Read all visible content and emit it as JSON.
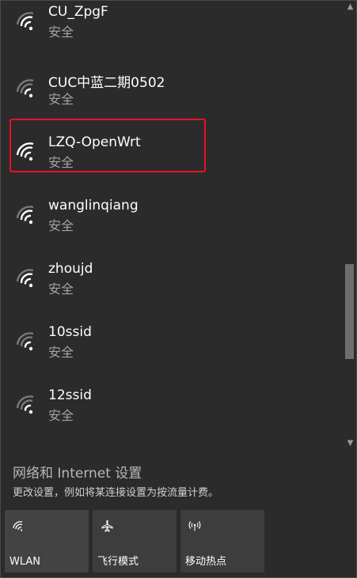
{
  "networks": [
    {
      "ssid": "CU_ZpgF",
      "status": "安全"
    },
    {
      "ssid": "CUC中蓝二期0502",
      "status": "安全"
    },
    {
      "ssid": "LZQ-OpenWrt",
      "status": "安全"
    },
    {
      "ssid": "wanglinqiang",
      "status": "安全"
    },
    {
      "ssid": "zhoujd",
      "status": "安全"
    },
    {
      "ssid": "10ssid",
      "status": "安全"
    },
    {
      "ssid": "12ssid",
      "status": "安全"
    }
  ],
  "settings": {
    "title": "网络和 Internet 设置",
    "subtitle": "更改设置，例如将某连接设置为按流量计费。"
  },
  "quick_actions": [
    {
      "label": "WLAN",
      "icon": "wifi-icon"
    },
    {
      "label": "飞行模式",
      "icon": "airplane-icon"
    },
    {
      "label": "移动热点",
      "icon": "hotspot-icon"
    }
  ],
  "colors": {
    "background": "#2b2b2b",
    "highlight": "#e81123",
    "tile": "#3d3d3d"
  }
}
